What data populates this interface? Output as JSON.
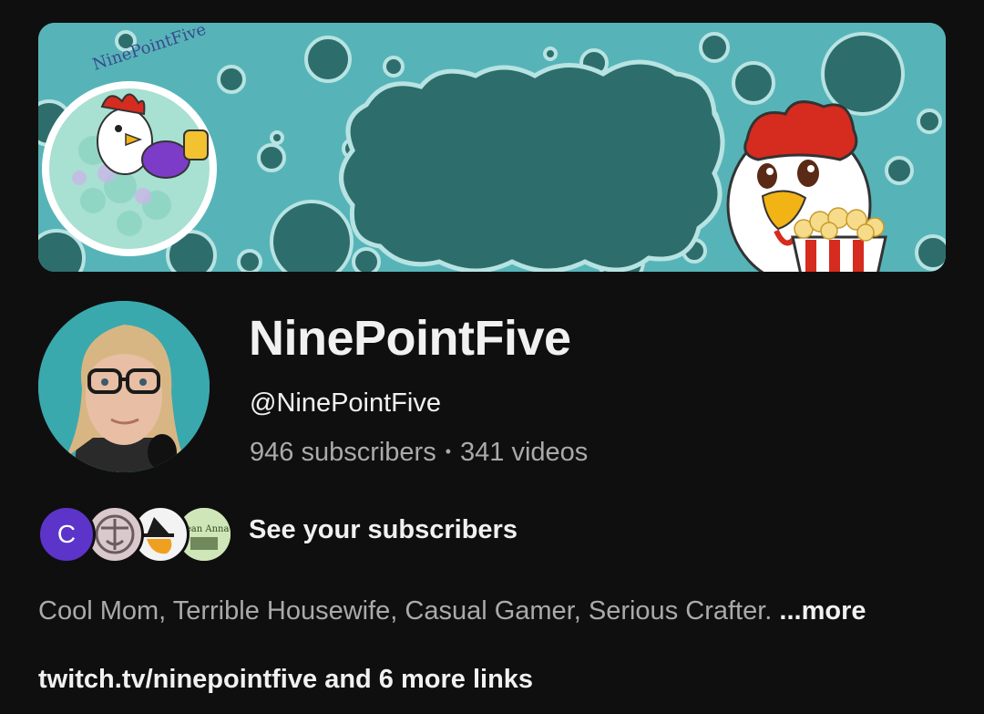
{
  "channel": {
    "name": "NinePointFive",
    "handle": "@NinePointFive",
    "subscribers": "946 subscribers",
    "separator": "•",
    "videos": "341 videos"
  },
  "banner": {
    "logo_text": "NinePointFive"
  },
  "subscribers_row": {
    "first_initial": "C",
    "label": "See your subscribers",
    "badge_text": "Bean Anna"
  },
  "description": {
    "text": "Cool Mom, Terrible Housewife, Casual Gamer, Serious Crafter.",
    "more_label": "...more"
  },
  "links": {
    "primary": "twitch.tv/ninepointfive",
    "more": "and 6 more links"
  },
  "colors": {
    "background": "#0f0f0f",
    "banner_teal": "#56b4b8",
    "banner_dark_teal": "#2d6e6c",
    "subscriber_c": "#5c34c9",
    "muted_text": "#aaaaaa"
  }
}
